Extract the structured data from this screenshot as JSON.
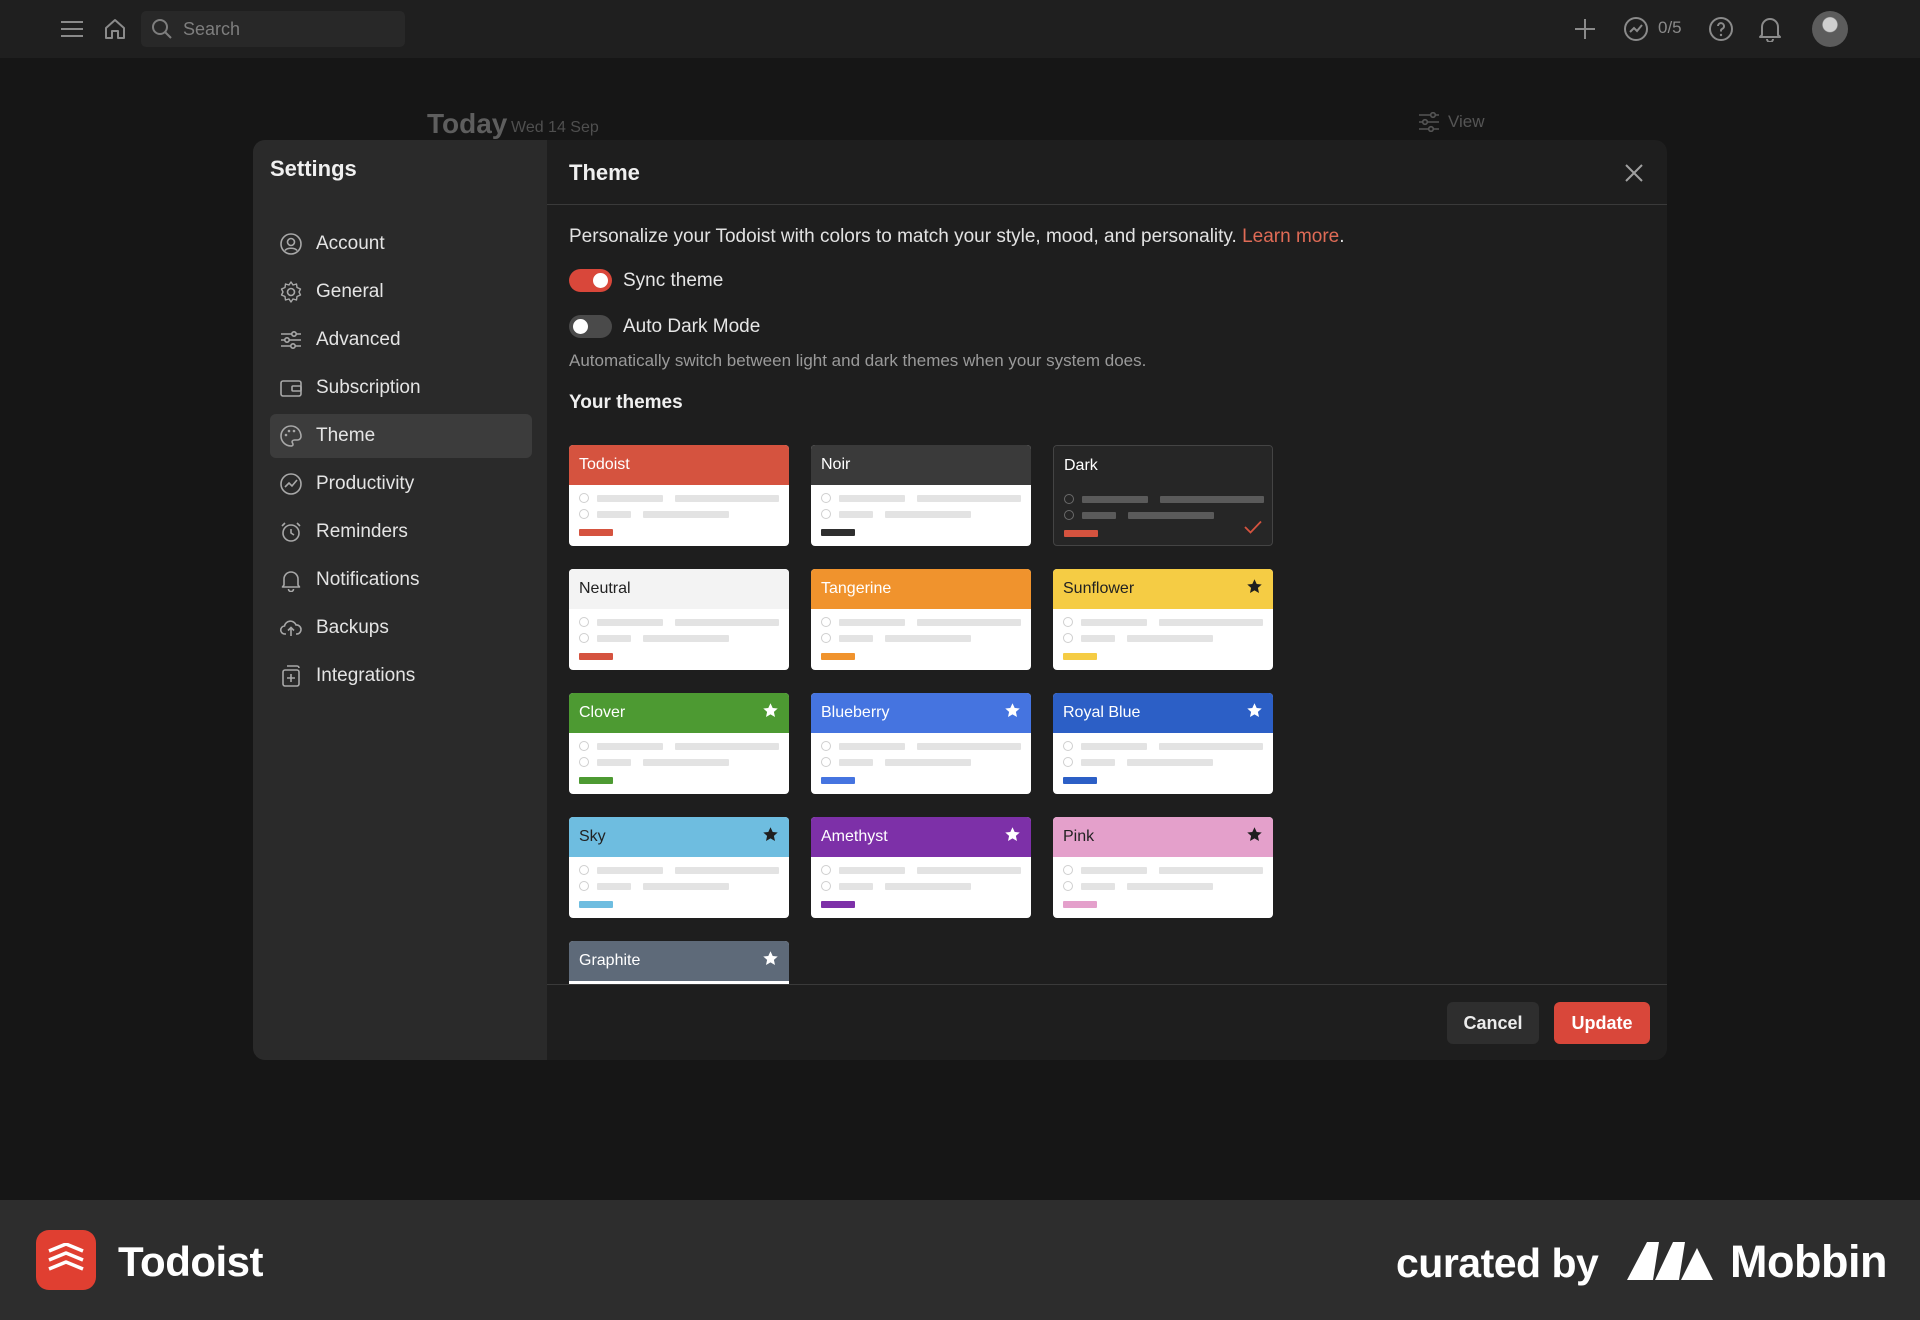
{
  "topbar": {
    "search_placeholder": "Search",
    "productivity_count": "0/5",
    "icons": [
      "menu-icon",
      "home-icon",
      "search-icon",
      "plus-icon",
      "productivity-icon",
      "help-icon",
      "bell-icon"
    ]
  },
  "background": {
    "title": "Today",
    "date": "Wed 14 Sep",
    "view_label": "View"
  },
  "settings": {
    "title": "Settings",
    "items": [
      {
        "label": "Account",
        "icon": "account-icon"
      },
      {
        "label": "General",
        "icon": "gear-icon"
      },
      {
        "label": "Advanced",
        "icon": "sliders-icon"
      },
      {
        "label": "Subscription",
        "icon": "wallet-icon"
      },
      {
        "label": "Theme",
        "icon": "palette-icon",
        "active": true
      },
      {
        "label": "Productivity",
        "icon": "productivity-icon"
      },
      {
        "label": "Reminders",
        "icon": "alarm-icon"
      },
      {
        "label": "Notifications",
        "icon": "bell-icon"
      },
      {
        "label": "Backups",
        "icon": "cloud-upload-icon"
      },
      {
        "label": "Integrations",
        "icon": "integrations-icon"
      }
    ]
  },
  "theme_panel": {
    "title": "Theme",
    "intro": "Personalize your Todoist with colors to match your style, mood, and personality.",
    "learn_more": "Learn more",
    "intro_end": ".",
    "sync_theme": {
      "label": "Sync theme",
      "on": true
    },
    "auto_dark": {
      "label": "Auto Dark Mode",
      "on": false
    },
    "auto_dark_hint": "Automatically switch between light and dark themes when your system does.",
    "your_themes": "Your themes",
    "themes": [
      {
        "name": "Todoist",
        "header": "#d5533f",
        "text": "#ffffff",
        "accent": "#d5533f",
        "star": null,
        "dark": false,
        "selected": false
      },
      {
        "name": "Noir",
        "header": "#3a3a3a",
        "text": "#ffffff",
        "accent": "#2f2f2f",
        "star": null,
        "dark": false,
        "selected": false
      },
      {
        "name": "Dark",
        "header": "#262626",
        "text": "#ffffff",
        "accent": "#d5533f",
        "star": null,
        "dark": true,
        "selected": true
      },
      {
        "name": "Neutral",
        "header": "#f3f3f3",
        "text": "#222222",
        "accent": "#d5533f",
        "star": null,
        "dark": false,
        "selected": false
      },
      {
        "name": "Tangerine",
        "header": "#f0932d",
        "text": "#ffffff",
        "accent": "#f0932d",
        "star": null,
        "dark": false,
        "selected": false
      },
      {
        "name": "Sunflower",
        "header": "#f5cc44",
        "text": "#222222",
        "accent": "#f5cc44",
        "star": "dark",
        "dark": false,
        "selected": false
      },
      {
        "name": "Clover",
        "header": "#4d9a32",
        "text": "#ffffff",
        "accent": "#4d9a32",
        "star": "light",
        "dark": false,
        "selected": false
      },
      {
        "name": "Blueberry",
        "header": "#4574e0",
        "text": "#ffffff",
        "accent": "#4574e0",
        "star": "light",
        "dark": false,
        "selected": false
      },
      {
        "name": "Royal Blue",
        "header": "#2c5fc6",
        "text": "#ffffff",
        "accent": "#2c5fc6",
        "star": "light",
        "dark": false,
        "selected": false
      },
      {
        "name": "Sky",
        "header": "#6ebde0",
        "text": "#222222",
        "accent": "#6ebde0",
        "star": "dark",
        "dark": false,
        "selected": false
      },
      {
        "name": "Amethyst",
        "header": "#7d30a8",
        "text": "#ffffff",
        "accent": "#7d30a8",
        "star": "light",
        "dark": false,
        "selected": false
      },
      {
        "name": "Pink",
        "header": "#e4a0cb",
        "text": "#222222",
        "accent": "#e4a0cb",
        "star": "dark",
        "dark": false,
        "selected": false
      },
      {
        "name": "Graphite",
        "header": "#5e6a79",
        "text": "#ffffff",
        "accent": "#5e6a79",
        "star": "light",
        "dark": false,
        "selected": false
      }
    ],
    "cancel": "Cancel",
    "update": "Update"
  },
  "branding": {
    "app_name": "Todoist",
    "curated_by": "curated by",
    "mobbin": "Mobbin"
  },
  "colors": {
    "accent": "#d9473a",
    "link": "#e06b56"
  }
}
